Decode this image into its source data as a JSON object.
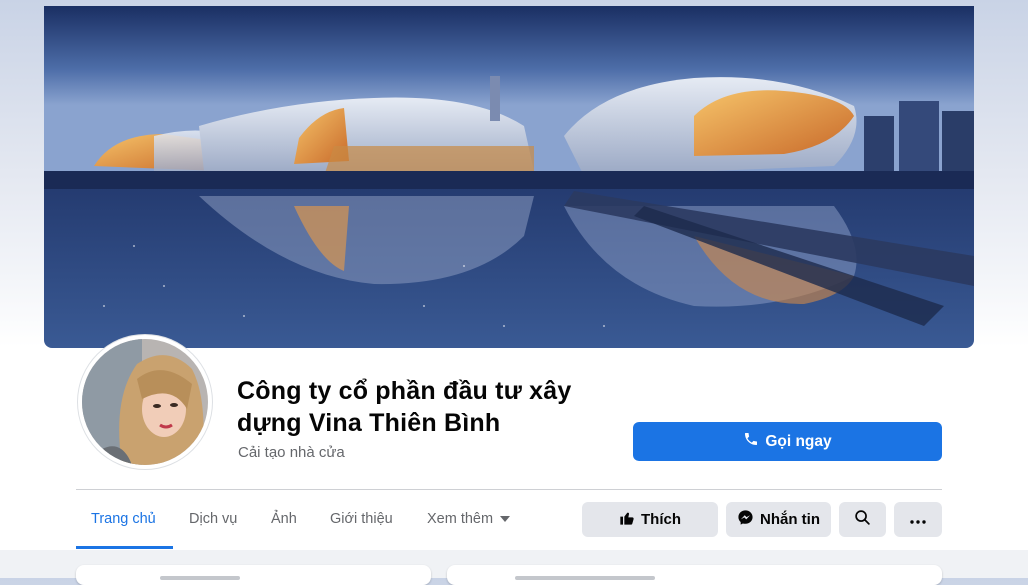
{
  "page": {
    "name": "Công ty cổ phần đầu tư xây dựng Vina Thiên Bình",
    "category": "Cải tạo nhà cửa"
  },
  "actions": {
    "call_label": "Gọi ngay",
    "like_label": "Thích",
    "message_label": "Nhắn tin"
  },
  "tabs": [
    {
      "label": "Trang chủ",
      "active": true
    },
    {
      "label": "Dịch vụ"
    },
    {
      "label": "Ảnh"
    },
    {
      "label": "Giới thiệu"
    },
    {
      "label": "Xem thêm"
    }
  ],
  "icons": {
    "call": "phone-icon",
    "like": "thumbs-up-icon",
    "message": "messenger-icon",
    "search": "search-icon",
    "more": "more-dots-icon",
    "dropdown": "caret-down-icon"
  },
  "colors": {
    "accent": "#1b74e4",
    "button_gray": "#e4e6eb",
    "secondary_text": "#65676b"
  }
}
